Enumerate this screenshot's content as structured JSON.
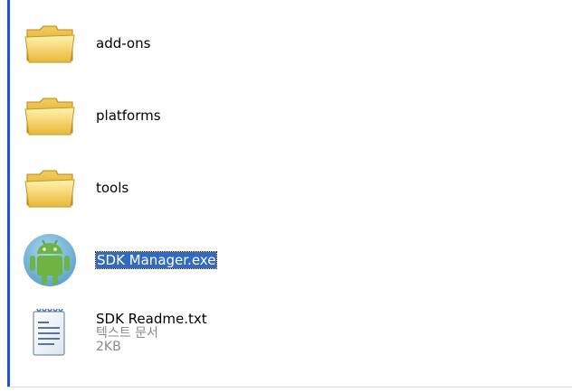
{
  "files": [
    {
      "name": "add-ons",
      "icon": "folder-icon"
    },
    {
      "name": "platforms",
      "icon": "folder-icon"
    },
    {
      "name": "tools",
      "icon": "folder-icon"
    },
    {
      "name": "SDK Manager.exe",
      "icon": "android-icon",
      "selected": true
    },
    {
      "name": "SDK Readme.txt",
      "icon": "notepad-document-icon",
      "type": "텍스트 문서",
      "size": "2KB"
    }
  ],
  "colors": {
    "selection": "#316ac5",
    "edge": "#1d56d6",
    "meta_text": "#8a8a8a"
  }
}
